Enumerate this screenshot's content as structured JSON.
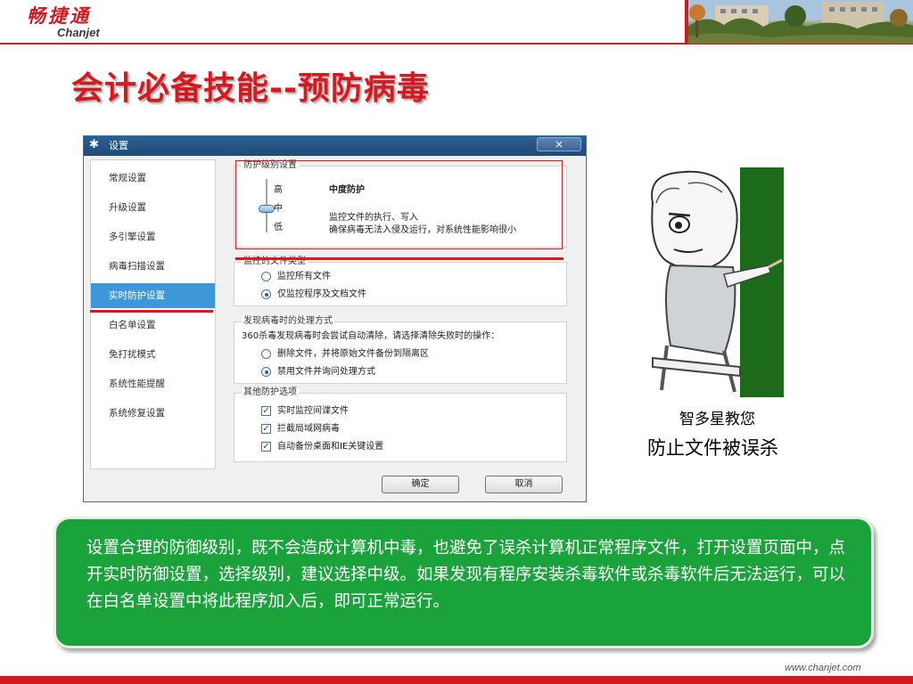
{
  "brand": {
    "logo_cn": "畅捷通",
    "logo_en": "Chanjet",
    "footer_url": "www.chanjet.com",
    "red": "#d41921",
    "green": "#1aa33b"
  },
  "page": {
    "title": "会计必备技能--预防病毒"
  },
  "dialog": {
    "title": "设置",
    "close_glyph": "×",
    "sidebar": [
      {
        "label": "常规设置"
      },
      {
        "label": "升级设置"
      },
      {
        "label": "多引擎设置"
      },
      {
        "label": "病毒扫描设置"
      },
      {
        "label": "实时防护设置",
        "active": true
      },
      {
        "label": "白名单设置"
      },
      {
        "label": "免打扰模式"
      },
      {
        "label": "系统性能提醒"
      },
      {
        "label": "系统修复设置"
      }
    ],
    "level_group": {
      "label": "防护级别设置",
      "levels": [
        "高",
        "中",
        "低"
      ],
      "selected_level": "中",
      "level_name": "中度防护",
      "desc_1": "监控文件的执行、写入",
      "desc_2": "确保病毒无法入侵及运行，对系统性能影响很小"
    },
    "monitor_group": {
      "label": "监控的文件类型",
      "options": [
        {
          "label": "监控所有文件",
          "selected": false
        },
        {
          "label": "仅监控程序及文档文件",
          "selected": true
        }
      ]
    },
    "handle_group": {
      "label": "发现病毒时的处理方式",
      "intro": "360杀毒发现病毒时会尝试自动清除，请选择清除失败时的操作：",
      "options": [
        {
          "label": "删除文件，并将原始文件备份到隔离区",
          "selected": false
        },
        {
          "label": "禁用文件并询问处理方式",
          "selected": true
        }
      ]
    },
    "other_group": {
      "label": "其他防护选项",
      "options": [
        {
          "label": "实时监控间谍文件",
          "checked": true
        },
        {
          "label": "拦截局域网病毒",
          "checked": true
        },
        {
          "label": "自动备份桌面和IE关键设置",
          "checked": true
        }
      ]
    },
    "ok_label": "确定",
    "cancel_label": "取消"
  },
  "cartoon": {
    "caption_small": "智多星教您",
    "caption_large": "防止文件被误杀"
  },
  "note": {
    "text": "设置合理的防御级别，既不会造成计算机中毒，也避免了误杀计算机正常程序文件，打开设置页面中，点开实时防御设置，选择级别，建议选择中级。如果发现有程序安装杀毒软件或杀毒软件后无法运行，可以在白名单设置中将此程序加入后，即可正常运行。"
  }
}
